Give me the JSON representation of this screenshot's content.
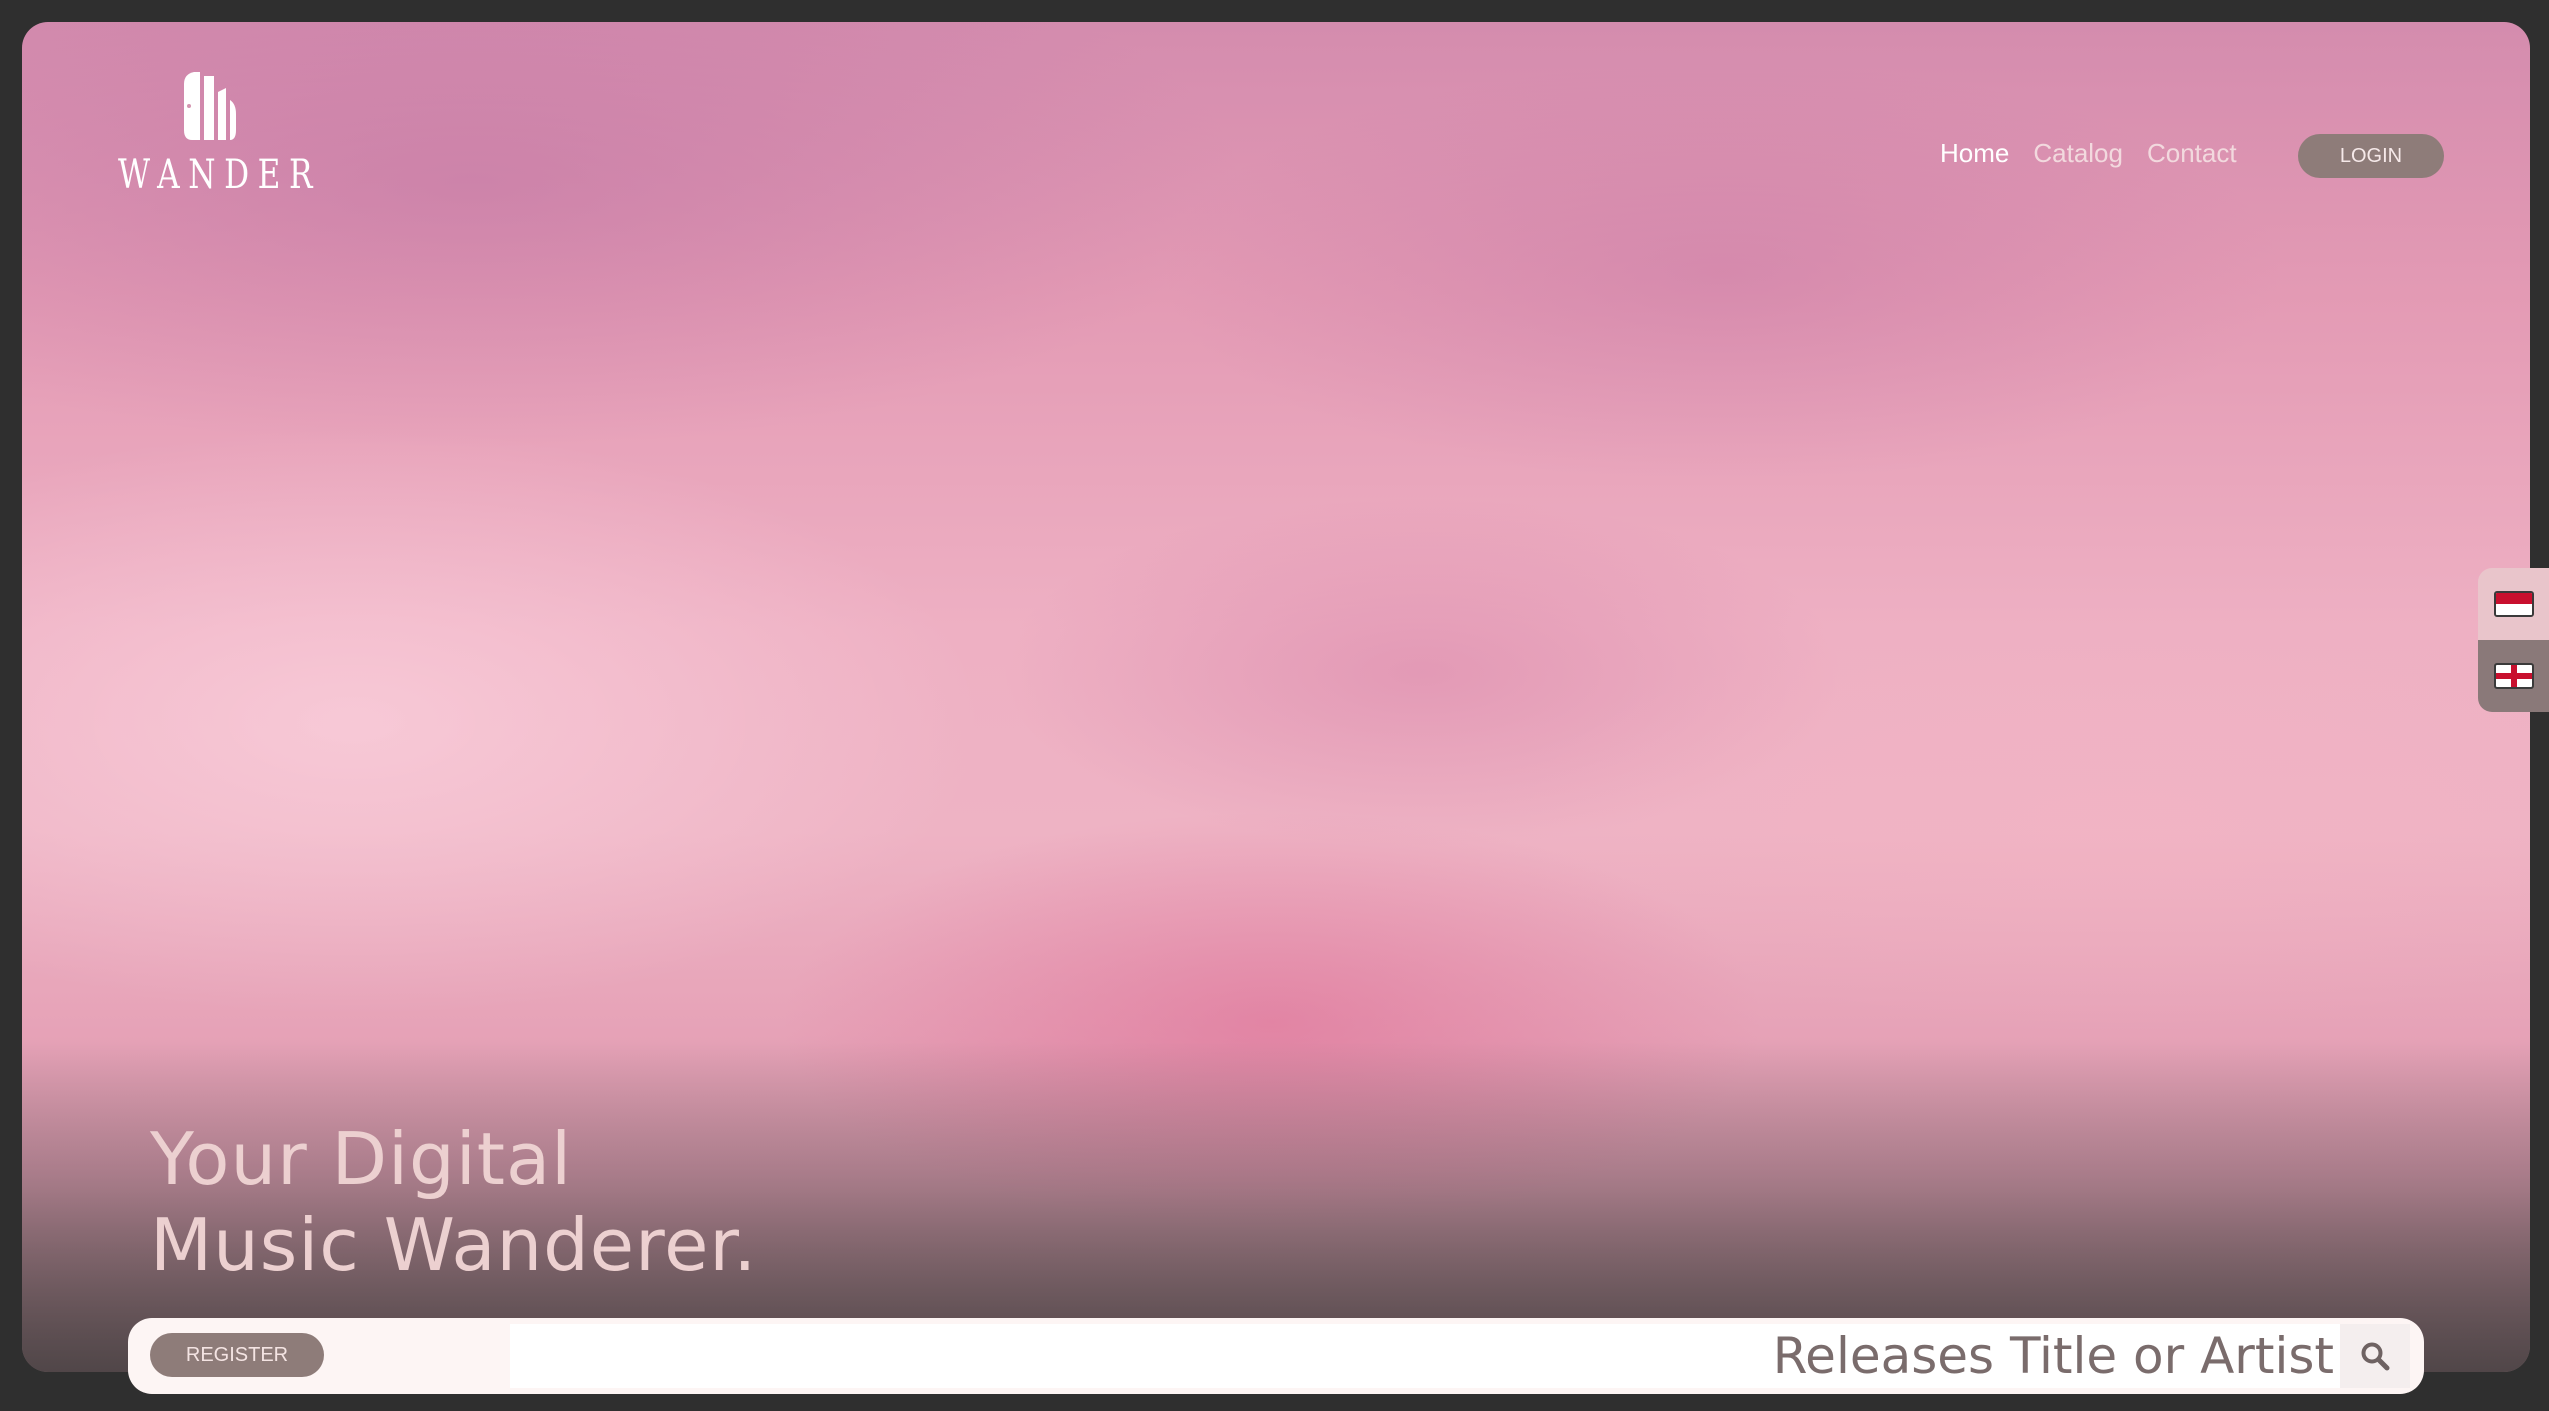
{
  "brand": {
    "name": "WANDER",
    "logo_icon": "wander-logo-icon"
  },
  "nav": {
    "items": [
      {
        "label": "Home",
        "active": true
      },
      {
        "label": "Catalog",
        "active": false
      },
      {
        "label": "Contact",
        "active": false
      }
    ],
    "login_label": "LOGIN"
  },
  "language": {
    "options": [
      {
        "code": "id",
        "icon": "indonesia-flag-icon"
      },
      {
        "code": "en",
        "icon": "england-flag-icon"
      }
    ]
  },
  "hero": {
    "line1": "Your Digital",
    "line2": "Music Wanderer."
  },
  "search": {
    "register_label": "REGISTER",
    "placeholder": "Releases Title or Artist",
    "value": "",
    "button_icon": "search-icon"
  },
  "colors": {
    "button_bg": "#8e7c79",
    "headline": "#ecd0d0",
    "search_bg": "#fdf5f4",
    "frame_bg": "#2f2f2f"
  }
}
